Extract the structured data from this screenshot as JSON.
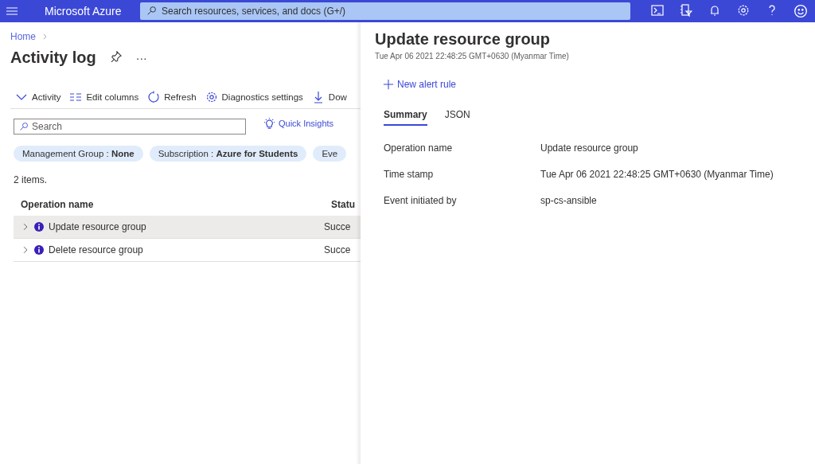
{
  "topbar": {
    "brand": "Microsoft Azure",
    "search": {
      "placeholder": "Search resources, services, and docs (G+/)"
    }
  },
  "breadcrumb": [
    "Home"
  ],
  "page": {
    "title": "Activity log",
    "more": "···"
  },
  "toolbar": [
    {
      "kind": "chevron",
      "label": "Activity"
    },
    {
      "kind": "columns",
      "label": "Edit columns"
    },
    {
      "kind": "refresh",
      "label": "Refresh"
    },
    {
      "kind": "gear",
      "label": "Diagnostics settings"
    },
    {
      "kind": "download",
      "label": "Dow"
    }
  ],
  "search": {
    "placeholder": "Search"
  },
  "quick_insights": "Quick Insights",
  "filters": [
    {
      "label": "Management Group : ",
      "value": "None"
    },
    {
      "label": "Subscription : ",
      "value": "Azure for Students"
    },
    {
      "label": "Eve"
    }
  ],
  "count": "2 items.",
  "table": {
    "columns": [
      "Operation name",
      "Statu"
    ],
    "rows": [
      {
        "name": "Update resource group",
        "status": "Succe",
        "selected": true
      },
      {
        "name": "Delete resource group",
        "status": "Succe",
        "selected": false
      }
    ]
  },
  "panel": {
    "title": "Update resource group",
    "subtitle": "Tue Apr 06 2021 22:48:25 GMT+0630 (Myanmar Time)",
    "action": "New alert rule",
    "tabs": [
      {
        "label": "Summary",
        "selected": true
      },
      {
        "label": "JSON",
        "selected": false
      }
    ],
    "fields": [
      {
        "label": "Operation name",
        "value": "Update resource group"
      },
      {
        "label": "Time stamp",
        "value": "Tue Apr 06 2021 22:48:25 GMT+0630 (Myanmar Time)"
      },
      {
        "label": "Event initiated by",
        "value": "sp-cs-ansible"
      }
    ]
  }
}
